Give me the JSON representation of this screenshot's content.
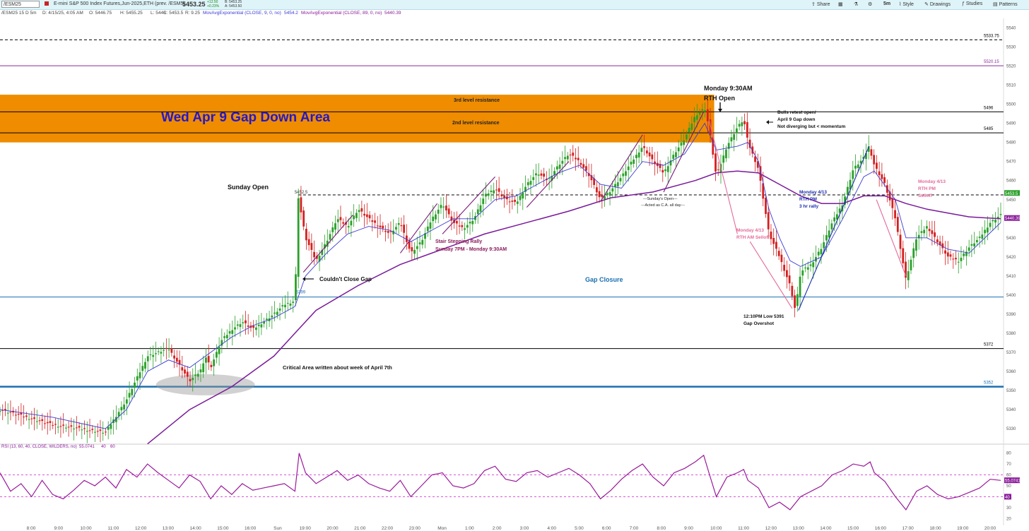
{
  "toolbar": {
    "symbol": "/ESM25",
    "description": "E-mini S&P 500 Index Futures,Jun-2025,ETH (prev. /ESM5)",
    "last_price": "5453.25",
    "change": "+12.50",
    "change_pct": "+0.23%",
    "bid": "B: 5453.25",
    "ask": "A: 5453.50",
    "buttons": [
      "Share",
      "5m",
      "Style",
      "Drawings",
      "Studies",
      "Patterns"
    ]
  },
  "info": {
    "label": "/ESM25 15 D 5m",
    "date": "D: 4/15/25, 4:05 AM",
    "open": "O: 5446.75",
    "high": "H: 5455.25",
    "low": "L: 5446",
    "close": "C: 5453.5",
    "range": "R: 9.25",
    "ema9_label": "MovAvgExponential (CLOSE, 9, 0, no)",
    "ema9_value": "5454.2",
    "ema89_label": "MovAvgExponential (CLOSE, 89, 0, no)",
    "ema89_value": "5440.39"
  },
  "rsi_info": {
    "label": "RSI (13, 60, 40, CLOSE, WILDERS, no)",
    "value": "55.0741",
    "ob": "40",
    "os": "60"
  },
  "colors": {
    "up": "#2aa02a",
    "down": "#d42020",
    "ema9": "#3b3bd6",
    "ema89": "#7a1a9a",
    "resistance_zone": "#ef8c00",
    "rsi": "#9a1a9a"
  },
  "chart_data": {
    "type": "candlestick",
    "y_axis": {
      "range": [
        5323,
        5545
      ],
      "ticks": [
        5330,
        5340,
        5350,
        5360,
        5370,
        5380,
        5390,
        5400,
        5410,
        5420,
        5430,
        5440,
        5450,
        5460,
        5470,
        5480,
        5490,
        5500,
        5510,
        5520,
        5530,
        5540
      ],
      "side": "right"
    },
    "x_axis": {
      "labels": [
        "8:00",
        "9:00",
        "10:00",
        "11:00",
        "12:00",
        "13:00",
        "14:00",
        "15:00",
        "16:00",
        "Sun",
        "19:00",
        "20:00",
        "21:00",
        "22:00",
        "23:00",
        "Mon",
        "1:00",
        "2:00",
        "3:00",
        "4:00",
        "5:00",
        "6:00",
        "7:00",
        "8:00",
        "9:00",
        "10:00",
        "11:00",
        "12:00",
        "13:00",
        "14:00",
        "15:00",
        "16:00",
        "17:00",
        "18:00",
        "19:00",
        "20:00"
      ]
    },
    "close_path": [
      [
        0,
        5340
      ],
      [
        5,
        5332
      ],
      [
        10,
        5328
      ],
      [
        12,
        5345
      ],
      [
        14,
        5368
      ],
      [
        16,
        5372
      ],
      [
        18,
        5355
      ],
      [
        19,
        5360
      ],
      [
        19.5,
        5368
      ],
      [
        20,
        5362
      ],
      [
        21,
        5376
      ],
      [
        22,
        5382
      ],
      [
        23,
        5386
      ],
      [
        24,
        5382
      ],
      [
        25,
        5386
      ],
      [
        26,
        5390
      ],
      [
        27,
        5395
      ],
      [
        28,
        5397
      ],
      [
        28.3,
        5452
      ],
      [
        29,
        5430
      ],
      [
        30,
        5418
      ],
      [
        31,
        5428
      ],
      [
        32,
        5440
      ],
      [
        33,
        5436
      ],
      [
        34,
        5445
      ],
      [
        35,
        5440
      ],
      [
        36,
        5436
      ],
      [
        37,
        5432
      ],
      [
        38,
        5438
      ],
      [
        39,
        5422
      ],
      [
        40,
        5428
      ],
      [
        41,
        5440
      ],
      [
        42,
        5448
      ],
      [
        43,
        5438
      ],
      [
        44,
        5435
      ],
      [
        45,
        5440
      ],
      [
        46,
        5452
      ],
      [
        47,
        5456
      ],
      [
        48,
        5450
      ],
      [
        49,
        5448
      ],
      [
        50,
        5458
      ],
      [
        51,
        5464
      ],
      [
        52,
        5460
      ],
      [
        53,
        5468
      ],
      [
        54,
        5474
      ],
      [
        55,
        5470
      ],
      [
        56,
        5462
      ],
      [
        57,
        5450
      ],
      [
        58,
        5455
      ],
      [
        59,
        5462
      ],
      [
        60,
        5470
      ],
      [
        61,
        5478
      ],
      [
        62,
        5470
      ],
      [
        63,
        5464
      ],
      [
        64,
        5474
      ],
      [
        65,
        5482
      ],
      [
        66,
        5494
      ],
      [
        66.9,
        5498
      ],
      [
        67.3,
        5488
      ],
      [
        68,
        5462
      ],
      [
        69,
        5478
      ],
      [
        70,
        5488
      ],
      [
        70.6,
        5492
      ],
      [
        71,
        5480
      ],
      [
        72,
        5466
      ],
      [
        73,
        5432
      ],
      [
        74,
        5420
      ],
      [
        75,
        5405
      ],
      [
        75.5,
        5392
      ],
      [
        76,
        5412
      ],
      [
        77,
        5416
      ],
      [
        78,
        5425
      ],
      [
        79,
        5438
      ],
      [
        80,
        5448
      ],
      [
        81,
        5466
      ],
      [
        82,
        5472
      ],
      [
        82.5,
        5478
      ],
      [
        83,
        5468
      ],
      [
        84,
        5458
      ],
      [
        85,
        5440
      ],
      [
        86,
        5408
      ],
      [
        87,
        5430
      ],
      [
        88,
        5436
      ],
      [
        89,
        5428
      ],
      [
        90,
        5420
      ],
      [
        91,
        5418
      ],
      [
        92,
        5425
      ],
      [
        93,
        5430
      ],
      [
        94,
        5438
      ],
      [
        95,
        5442
      ]
    ],
    "ema9_path": [
      [
        0,
        5340
      ],
      [
        5,
        5336
      ],
      [
        10,
        5330
      ],
      [
        12,
        5340
      ],
      [
        14,
        5360
      ],
      [
        16,
        5366
      ],
      [
        18,
        5362
      ],
      [
        20,
        5370
      ],
      [
        22,
        5378
      ],
      [
        24,
        5384
      ],
      [
        26,
        5388
      ],
      [
        28,
        5394
      ],
      [
        29,
        5410
      ],
      [
        31,
        5422
      ],
      [
        33,
        5432
      ],
      [
        35,
        5436
      ],
      [
        37,
        5434
      ],
      [
        39,
        5428
      ],
      [
        41,
        5434
      ],
      [
        43,
        5440
      ],
      [
        45,
        5440
      ],
      [
        47,
        5450
      ],
      [
        49,
        5452
      ],
      [
        51,
        5458
      ],
      [
        53,
        5464
      ],
      [
        55,
        5468
      ],
      [
        57,
        5458
      ],
      [
        59,
        5456
      ],
      [
        61,
        5470
      ],
      [
        63,
        5468
      ],
      [
        65,
        5474
      ],
      [
        66.9,
        5490
      ],
      [
        68,
        5476
      ],
      [
        70,
        5478
      ],
      [
        71,
        5480
      ],
      [
        72,
        5470
      ],
      [
        73,
        5445
      ],
      [
        74,
        5430
      ],
      [
        75,
        5418
      ],
      [
        76,
        5415
      ],
      [
        78,
        5420
      ],
      [
        80,
        5440
      ],
      [
        82,
        5462
      ],
      [
        83,
        5465
      ],
      [
        85,
        5450
      ],
      [
        86,
        5430
      ],
      [
        88,
        5430
      ],
      [
        90,
        5424
      ],
      [
        92,
        5422
      ],
      [
        95,
        5438
      ]
    ],
    "ema89_path": [
      [
        14,
        5322
      ],
      [
        18,
        5340
      ],
      [
        22,
        5352
      ],
      [
        26,
        5368
      ],
      [
        28,
        5380
      ],
      [
        30,
        5392
      ],
      [
        34,
        5405
      ],
      [
        38,
        5416
      ],
      [
        42,
        5424
      ],
      [
        46,
        5432
      ],
      [
        50,
        5438
      ],
      [
        54,
        5444
      ],
      [
        58,
        5451
      ],
      [
        62,
        5454
      ],
      [
        66,
        5460
      ],
      [
        68,
        5464
      ],
      [
        70,
        5465
      ],
      [
        72,
        5464
      ],
      [
        74,
        5458
      ],
      [
        76,
        5452
      ],
      [
        78,
        5448
      ],
      [
        80,
        5448
      ],
      [
        82,
        5452
      ],
      [
        84,
        5452
      ],
      [
        86,
        5448
      ],
      [
        88,
        5445
      ],
      [
        90,
        5443
      ],
      [
        92,
        5441
      ],
      [
        95,
        5440
      ]
    ],
    "rsi_path": [
      [
        0,
        62
      ],
      [
        1,
        45
      ],
      [
        2,
        52
      ],
      [
        3,
        40
      ],
      [
        4,
        55
      ],
      [
        5,
        42
      ],
      [
        6,
        38
      ],
      [
        7,
        46
      ],
      [
        8,
        55
      ],
      [
        9,
        50
      ],
      [
        10,
        58
      ],
      [
        11,
        48
      ],
      [
        12,
        65
      ],
      [
        13,
        58
      ],
      [
        14,
        70
      ],
      [
        15,
        62
      ],
      [
        16,
        55
      ],
      [
        17,
        48
      ],
      [
        18,
        60
      ],
      [
        19,
        54
      ],
      [
        20,
        38
      ],
      [
        21,
        50
      ],
      [
        22,
        42
      ],
      [
        23,
        52
      ],
      [
        24,
        46
      ],
      [
        25,
        48
      ],
      [
        26,
        50
      ],
      [
        27,
        52
      ],
      [
        28,
        45
      ],
      [
        28.4,
        80
      ],
      [
        29,
        62
      ],
      [
        30,
        52
      ],
      [
        31,
        58
      ],
      [
        32,
        64
      ],
      [
        33,
        55
      ],
      [
        34,
        60
      ],
      [
        35,
        52
      ],
      [
        36,
        48
      ],
      [
        37,
        45
      ],
      [
        38,
        55
      ],
      [
        39,
        40
      ],
      [
        40,
        50
      ],
      [
        41,
        60
      ],
      [
        42,
        62
      ],
      [
        43,
        50
      ],
      [
        44,
        48
      ],
      [
        45,
        52
      ],
      [
        46,
        64
      ],
      [
        47,
        68
      ],
      [
        48,
        56
      ],
      [
        49,
        54
      ],
      [
        50,
        62
      ],
      [
        51,
        64
      ],
      [
        52,
        58
      ],
      [
        53,
        62
      ],
      [
        54,
        66
      ],
      [
        55,
        60
      ],
      [
        56,
        52
      ],
      [
        57,
        38
      ],
      [
        58,
        46
      ],
      [
        59,
        56
      ],
      [
        60,
        64
      ],
      [
        61,
        70
      ],
      [
        62,
        58
      ],
      [
        63,
        50
      ],
      [
        64,
        62
      ],
      [
        65,
        66
      ],
      [
        66,
        72
      ],
      [
        66.8,
        78
      ],
      [
        67.3,
        62
      ],
      [
        68,
        40
      ],
      [
        69,
        58
      ],
      [
        70,
        62
      ],
      [
        70.6,
        65
      ],
      [
        71,
        55
      ],
      [
        72,
        48
      ],
      [
        73,
        30
      ],
      [
        74,
        35
      ],
      [
        75,
        28
      ],
      [
        76,
        40
      ],
      [
        77,
        45
      ],
      [
        78,
        50
      ],
      [
        79,
        60
      ],
      [
        80,
        64
      ],
      [
        81,
        70
      ],
      [
        82,
        68
      ],
      [
        82.6,
        72
      ],
      [
        83,
        62
      ],
      [
        84,
        54
      ],
      [
        85,
        40
      ],
      [
        86,
        28
      ],
      [
        87,
        45
      ],
      [
        88,
        50
      ],
      [
        89,
        42
      ],
      [
        90,
        38
      ],
      [
        91,
        40
      ],
      [
        92,
        44
      ],
      [
        93,
        48
      ],
      [
        94,
        56
      ],
      [
        95,
        55
      ]
    ],
    "rsi_axis": {
      "range": [
        15,
        85
      ],
      "ticks": [
        20,
        30,
        40,
        50,
        60,
        70,
        80
      ],
      "levels": [
        40,
        60
      ]
    },
    "levels": [
      {
        "name": "5533.75",
        "value": 5533.75,
        "style": "dashed",
        "color": "#000000",
        "label": "5533.75"
      },
      {
        "name": "5520.15",
        "value": 5520.15,
        "style": "solid",
        "color": "#8a2a9a",
        "label": "5520.15"
      },
      {
        "name": "5496",
        "value": 5496,
        "style": "solid",
        "color": "#000000",
        "label": "5496"
      },
      {
        "name": "5485",
        "value": 5485,
        "style": "solid",
        "color": "#000000",
        "label": "5485"
      },
      {
        "name": "5452.5",
        "value": 5452.5,
        "style": "dashed",
        "color": "#000000",
        "label": "5452.5"
      },
      {
        "name": "5399",
        "value": 5399,
        "style": "solid",
        "color": "#1a6fb0",
        "label": "5399"
      },
      {
        "name": "5372",
        "value": 5372,
        "style": "solid",
        "color": "#000000",
        "label": "5372"
      },
      {
        "name": "5352",
        "value": 5352,
        "style": "solid",
        "color": "#1a6fb0",
        "label": "5352"
      }
    ],
    "price_tags": [
      {
        "text": "5453.5",
        "value": 5453.5,
        "color": "#2aa02a"
      },
      {
        "text": "5440.39",
        "value": 5440.39,
        "color": "#8a1a9a"
      }
    ],
    "rsi_tags": [
      {
        "text": "55.0741",
        "value": 55.07,
        "color": "#8a1a9a"
      },
      {
        "text": "40",
        "value": 40,
        "color": "#8a1a9a"
      }
    ],
    "zone": {
      "low": 5480,
      "high": 5505,
      "label": "Wed Apr 9 Gap Down Area"
    },
    "annotations": [
      "3rd level resistance",
      "2nd level resistance",
      "Monday 9:30AM",
      "RTH Open",
      "Sunday Open",
      "Couldn't Close Gap",
      "Stair Stepping Rally",
      "Sunday 7PM - Monday 9:30AM",
      "Gap Closure",
      "---Sunday's Open---",
      "---Acted as C.A. all day---",
      "Bulls retest open/",
      "April 9 Gap down",
      "Not diverging but < momentum",
      "Monday 4/13",
      "RTH AM Selloff",
      "Monday 4/13",
      "RTH PM",
      "3 hr rally",
      "Monday 4/13",
      "RTH PM",
      "Selloff",
      "12:10PM Low 5391",
      "Gap Overshot",
      "Critical Area written about week of April 7th"
    ]
  }
}
